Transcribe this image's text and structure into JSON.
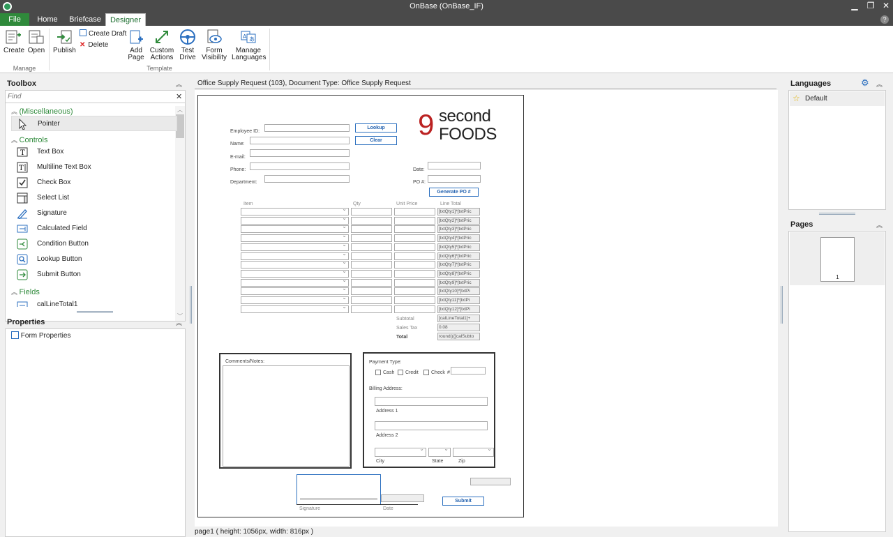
{
  "window": {
    "title": "OnBase (OnBase_IF)"
  },
  "ribbon_tabs": [
    "File",
    "Home",
    "Briefcase",
    "Designer"
  ],
  "ribbon": {
    "create": "Create",
    "open": "Open",
    "publish": "Publish",
    "create_draft": "Create Draft",
    "delete": "Delete",
    "add_page_1": "Add",
    "add_page_2": "Page",
    "custom_actions_1": "Custom",
    "custom_actions_2": "Actions",
    "test_drive_1": "Test",
    "test_drive_2": "Drive",
    "form_visibility_1": "Form",
    "form_visibility_2": "Visibility",
    "manage_languages_1": "Manage",
    "manage_languages_2": "Languages",
    "group_manage": "Manage",
    "group_template": "Template"
  },
  "toolbox": {
    "title": "Toolbox",
    "find_placeholder": "Find",
    "sections": [
      {
        "label": "(Miscellaneous)"
      },
      {
        "label": "Controls"
      },
      {
        "label": "Fields"
      }
    ],
    "items": [
      {
        "label": "Pointer",
        "icon": "pointer-icon"
      },
      {
        "label": "Text Box",
        "icon": "text-box-icon"
      },
      {
        "label": "Multiline Text Box",
        "icon": "multiline-text-box-icon"
      },
      {
        "label": "Check Box",
        "icon": "check-box-icon"
      },
      {
        "label": "Select List",
        "icon": "select-list-icon"
      },
      {
        "label": "Signature",
        "icon": "signature-icon"
      },
      {
        "label": "Calculated Field",
        "icon": "calculated-field-icon"
      },
      {
        "label": "Condition Button",
        "icon": "condition-button-icon"
      },
      {
        "label": "Lookup Button",
        "icon": "lookup-button-icon"
      },
      {
        "label": "Submit Button",
        "icon": "submit-button-icon"
      },
      {
        "label": "calLineTotal1",
        "icon": "field-icon"
      }
    ]
  },
  "properties": {
    "title": "Properties",
    "item": "Form Properties"
  },
  "designer": {
    "header": "Office Supply Request (103), Document Type: Office Supply Request",
    "status": "page1 ( height: 1056px, width: 816px )"
  },
  "form": {
    "logo_top": "second",
    "logo_bottom": "FOODS",
    "logo_digit": "9",
    "employee_id": "Employee ID:",
    "name": "Name:",
    "email": "E-mail:",
    "phone": "Phone:",
    "department": "Department:",
    "date": "Date:",
    "po": "PO #:",
    "lookup": "Lookup",
    "clear": "Clear",
    "generate_po": "Generate PO #",
    "col_item": "Item",
    "col_qty": "Qty",
    "col_unit": "Unit Price",
    "col_total": "Line Total",
    "line_totals": [
      "[txtQty1]*[txtPric",
      "[txtQty2]*[txtPric",
      "[txtQty3]*[txtPric",
      "[txtQty4]*[txtPric",
      "[txtQty5]*[txtPric",
      "[txtQty6]*[txtPric",
      "[txtQty7]*[txtPric",
      "[txtQty8]*[txtPric",
      "[txtQty9]*[txtPric",
      "[txtQty10]*[txtPi",
      "[txtQty11]*[txtPi",
      "[txtQty12]*[txtPi"
    ],
    "subtotal": "Subtotal",
    "subtotal_val": "[calLineTotal1]+",
    "sales_tax": "Sales Tax",
    "sales_tax_val": "0.08",
    "total": "Total",
    "total_val": "round((([calSubto",
    "comments": "Comments/Notes:",
    "payment_type": "Payment Type:",
    "cash": "Cash",
    "credit": "Credit",
    "check": "Check",
    "hash": "#",
    "billing": "Billing Address:",
    "address1": "Address 1",
    "address2": "Address 2",
    "city": "City",
    "state": "State",
    "zip": "Zip",
    "signature": "Signature",
    "sig_date": "Date",
    "submit": "Submit"
  },
  "languages": {
    "title": "Languages",
    "default": "Default"
  },
  "pages": {
    "title": "Pages",
    "page_number": "1"
  },
  "colors": {
    "accent": "#2f8a3b",
    "title_bar": "#4a4a4a",
    "link_blue": "#1f5fae"
  }
}
